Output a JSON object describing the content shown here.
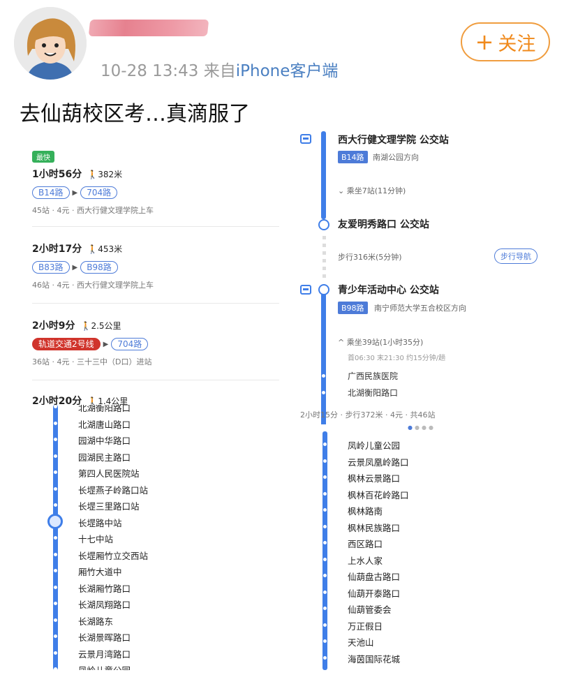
{
  "post": {
    "time": "10-28 13:43",
    "source_prefix": "来自",
    "source": "iPhone客户端",
    "follow_label": "关注",
    "text": "去仙葫校区考…真滴服了"
  },
  "routes": [
    {
      "badge": "最快",
      "duration": "1小时56分",
      "walk": "382米",
      "lines": [
        "B14路",
        "704路"
      ],
      "info": "45站 · 4元 · 西大行健文理学院上车"
    },
    {
      "badge": "",
      "duration": "2小时17分",
      "walk": "453米",
      "lines": [
        "B83路",
        "B98路"
      ],
      "info": "46站 · 4元 · 西大行健文理学院上车"
    },
    {
      "badge": "",
      "duration": "2小时9分",
      "walk": "2.5公里",
      "lines": [
        "轨道交通2号线",
        "704路"
      ],
      "info": "36站 · 4元 · 三十三中（D口）进站"
    },
    {
      "badge": "",
      "duration": "2小时20分",
      "walk": "1.4公里",
      "lines": [],
      "info": ""
    }
  ],
  "detail": {
    "stop1": "西大行健文理学院 公交站",
    "line1": "B14路",
    "dir1": "南湖公园方向",
    "ride1": "乘坐7站(11分钟)",
    "stop2": "友爱明秀路口 公交站",
    "walk": "步行316米(5分钟)",
    "walk_nav": "步行导航",
    "stop3": "青少年活动中心 公交站",
    "line2": "B98路",
    "dir2": "南宁师范大学五合校区方向",
    "ride2": "乘坐39站(1小时35分)",
    "times": "首06:30  末21:30  约15分钟/趟",
    "next_stops": [
      "广西民族医院",
      "北湖衡阳路口"
    ],
    "summary": "2小时15分 · 步行372米 · 4元 · 共46站"
  },
  "left_list": [
    "北湖衡阳路口",
    "北湖唐山路口",
    "园湖中华路口",
    "园湖民主路口",
    "第四人民医院站",
    "长堽燕子岭路口站",
    "长堽三里路口站",
    "长堽路中站",
    "十七中站",
    "长堽厢竹立交西站",
    "厢竹大道中",
    "长湖厢竹路口",
    "长湖凤翔路口",
    "长湖路东",
    "长湖景晖路口",
    "云景月湾路口",
    "凤岭儿童公园"
  ],
  "right_list": [
    "凤岭儿童公园",
    "云景凤凰岭路口",
    "枫林云景路口",
    "枫林百花岭路口",
    "枫林路南",
    "枫林民族路口",
    "西区路口",
    "上水人家",
    "仙葫盘古路口",
    "仙葫开泰路口",
    "仙葫管委会",
    "万正假日",
    "天池山",
    "海茵国际花城"
  ]
}
